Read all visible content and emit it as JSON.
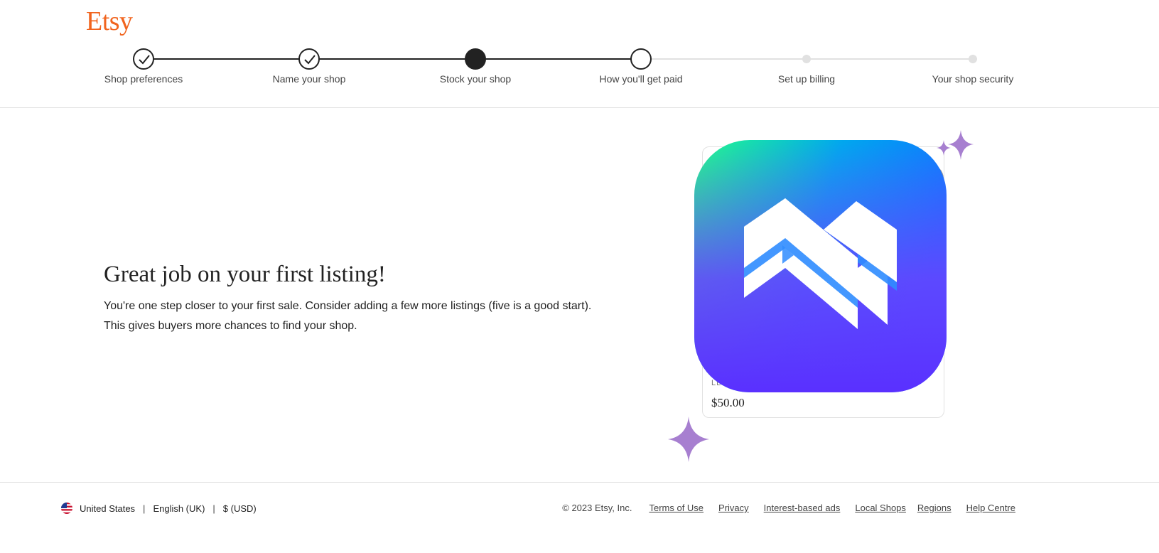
{
  "brand": {
    "logo_text": "Etsy",
    "accent": "#f1641e"
  },
  "stepper": {
    "steps": [
      {
        "label": "Shop preferences",
        "state": "completed"
      },
      {
        "label": "Name your shop",
        "state": "completed"
      },
      {
        "label": "Stock your shop",
        "state": "current"
      },
      {
        "label": "How you'll get paid",
        "state": "next"
      },
      {
        "label": "Set up billing",
        "state": "upcoming"
      },
      {
        "label": "Your shop security",
        "state": "upcoming"
      }
    ]
  },
  "main": {
    "headline": "Great job on your first listing!",
    "body_line_1": "You're one step closer to your first sale. Consider adding a few more listings (five is a good start).",
    "body_line_2": "This gives buyers more chances to find your shop."
  },
  "listing_card": {
    "meta_partial": "LL",
    "price": "$50.00"
  },
  "footer": {
    "region": "United States",
    "language": "English (UK)",
    "currency": "$ (USD)",
    "separator": "|",
    "copyright": "© 2023 Etsy, Inc.",
    "links": [
      "Terms of Use",
      "Privacy",
      "Interest-based ads",
      "Local Shops",
      "Regions",
      "Help Centre"
    ]
  }
}
